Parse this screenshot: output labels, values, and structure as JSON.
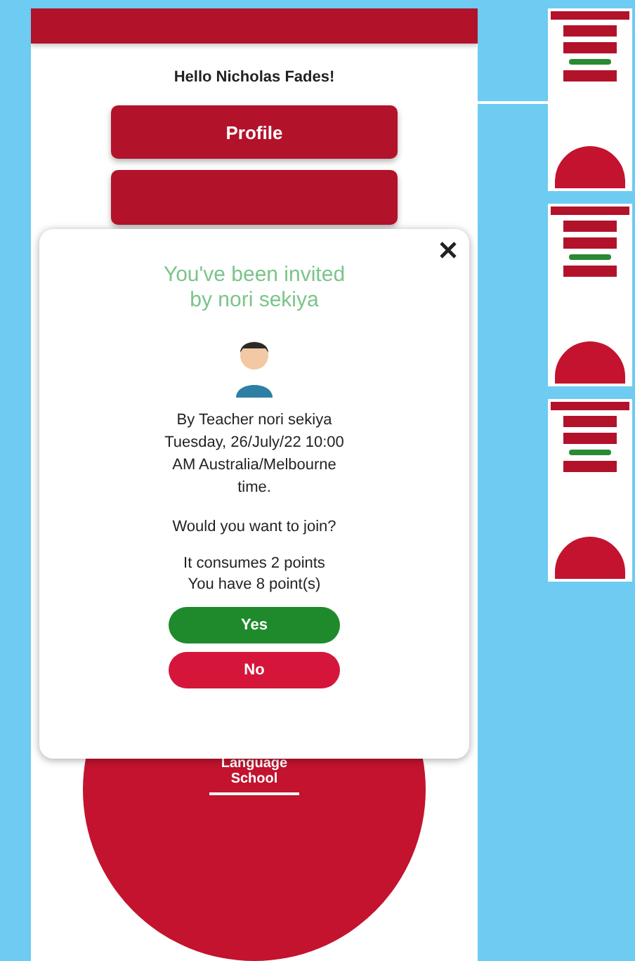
{
  "screen": {
    "greeting": "Hello Nicholas Fades!",
    "menu_buttons": [
      {
        "label": "Profile"
      }
    ],
    "illustration": {
      "caption": "Language School"
    }
  },
  "dialog": {
    "title": "You've been invited by nori sekiya",
    "details": "By Teacher nori sekiya Tuesday, 26/July/22 10:00 AM Australia/Melbourne time.",
    "question": "Would you want to join?",
    "points": [
      "It consumes 2 points",
      "You have 8 point(s)"
    ],
    "buttons": [
      {
        "label": "Yes",
        "kind": "confirm"
      },
      {
        "label": "No",
        "kind": "cancel"
      }
    ]
  }
}
